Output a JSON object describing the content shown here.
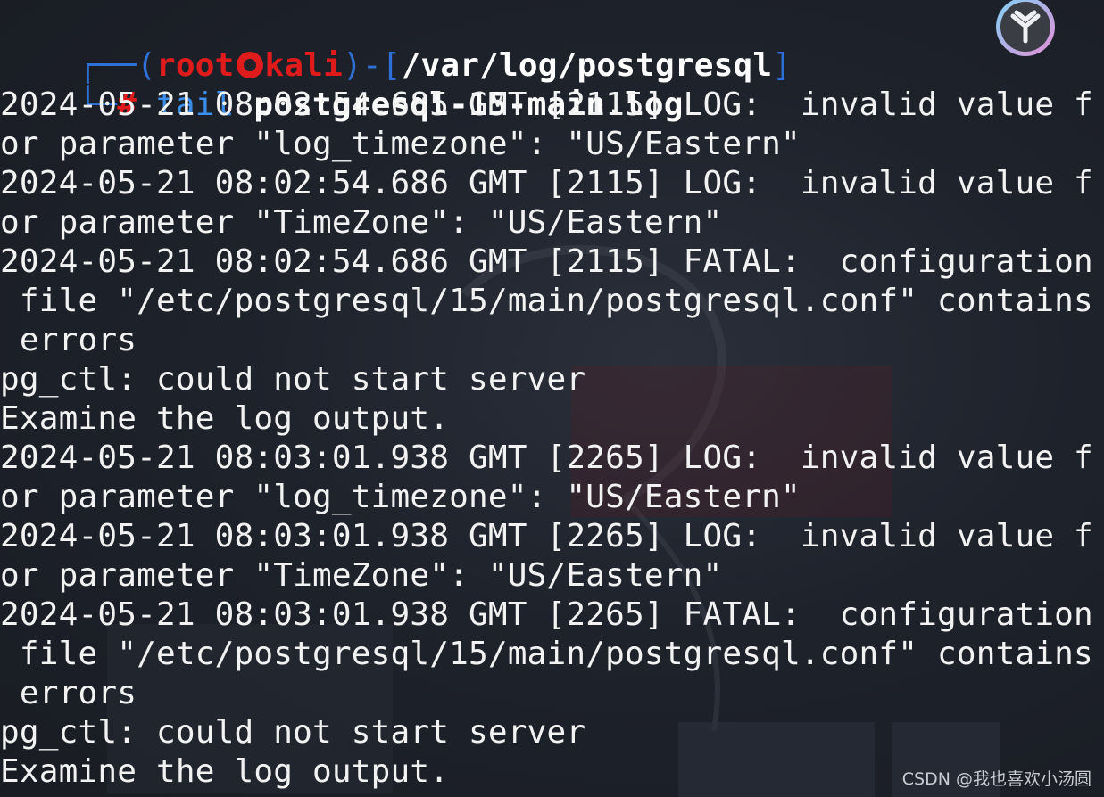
{
  "prompt": {
    "open_bracket": "┌──(",
    "user": "root",
    "host": "kali",
    "mid_bracket": ")-[",
    "path": "/var/log/postgresql",
    "close_bracket": "]",
    "second_prefix": "└─",
    "hash": "#",
    "command": "tail",
    "argument": "postgresql-15-main.log"
  },
  "output_lines": [
    "2024-05-21 08:02:54.685 GMT [2115] LOG:  invalid value f",
    "or parameter \"log_timezone\": \"US/Eastern\"",
    "2024-05-21 08:02:54.686 GMT [2115] LOG:  invalid value f",
    "or parameter \"TimeZone\": \"US/Eastern\"",
    "2024-05-21 08:02:54.686 GMT [2115] FATAL:  configuration",
    " file \"/etc/postgresql/15/main/postgresql.conf\" contains",
    " errors",
    "pg_ctl: could not start server",
    "Examine the log output.",
    "2024-05-21 08:03:01.938 GMT [2265] LOG:  invalid value f",
    "or parameter \"log_timezone\": \"US/Eastern\"",
    "2024-05-21 08:03:01.938 GMT [2265] LOG:  invalid value f",
    "or parameter \"TimeZone\": \"US/Eastern\"",
    "2024-05-21 08:03:01.938 GMT [2265] FATAL:  configuration",
    " file \"/etc/postgresql/15/main/postgresql.conf\" contains",
    " errors",
    "pg_ctl: could not start server",
    "Examine the log output."
  ],
  "watermark": "CSDN @我也喜欢小汤圆",
  "icons": {
    "prompt_separator": "kali-skull-icon",
    "corner_app": "app-logo-icon"
  },
  "colors": {
    "background": "#1e222b",
    "prompt_red": "#e01b1b",
    "prompt_blue": "#2f6fd8",
    "command_blue": "#3b8eea",
    "text": "#f2f2f2"
  }
}
